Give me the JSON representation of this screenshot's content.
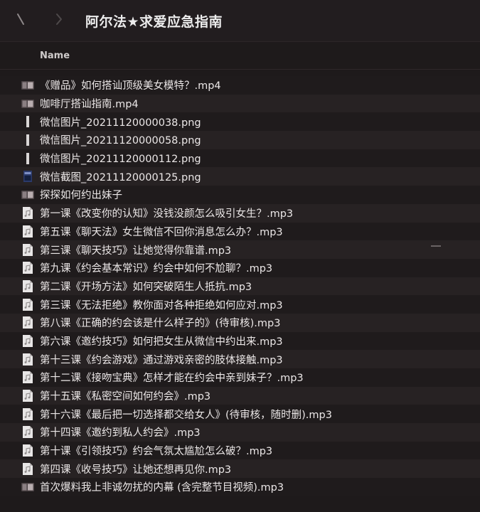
{
  "window": {
    "title": "阿尔法★求爱应急指南"
  },
  "header": {
    "name_column": "Name"
  },
  "files": [
    {
      "name": "《赠品》如何搭讪顶级美女模特？.mp4",
      "icon": "video-thumbnail-icon"
    },
    {
      "name": "咖啡厅搭讪指南.mp4",
      "icon": "video-thumbnail-icon"
    },
    {
      "name": "微信图片_20211120000038.png",
      "icon": "image-thumbnail-icon"
    },
    {
      "name": "微信图片_20211120000058.png",
      "icon": "image-thumbnail-icon"
    },
    {
      "name": "微信图片_20211120000112.png",
      "icon": "image-thumbnail-icon"
    },
    {
      "name": "微信截图_20211120000125.png",
      "icon": "screenshot-thumbnail-icon"
    },
    {
      "name": "探探如何约出妹子",
      "icon": "video-thumbnail-icon"
    },
    {
      "name": "第一课《改变你的认知》没钱没颜怎么吸引女生？.mp3",
      "icon": "audio-file-icon"
    },
    {
      "name": "第五课《聊天法》女生微信不回你消息怎么办？.mp3",
      "icon": "audio-file-icon"
    },
    {
      "name": "第三课《聊天技巧》让她觉得你靠谱.mp3",
      "icon": "audio-file-icon"
    },
    {
      "name": "第九课《约会基本常识》约会中如何不尬聊？.mp3",
      "icon": "audio-file-icon"
    },
    {
      "name": "第二课《开场方法》如何突破陌生人抵抗.mp3",
      "icon": "audio-file-icon"
    },
    {
      "name": "第三课《无法拒绝》教你面对各种拒绝如何应对.mp3",
      "icon": "audio-file-icon"
    },
    {
      "name": "第八课《正确的约会该是什么样子的》(待审核).mp3",
      "icon": "audio-file-icon"
    },
    {
      "name": "第六课《邀约技巧》如何把女生从微信中约出来.mp3",
      "icon": "audio-file-icon"
    },
    {
      "name": "第十三课《约会游戏》通过游戏亲密的肢体接触.mp3",
      "icon": "audio-file-icon"
    },
    {
      "name": "第十二课《接吻宝典》怎样才能在约会中亲到妹子？.mp3",
      "icon": "audio-file-icon"
    },
    {
      "name": "第十五课《私密空间如何约会》.mp3",
      "icon": "audio-file-icon"
    },
    {
      "name": "第十六课《最后把一切选择都交给女人》(待审核，随时删).mp3",
      "icon": "audio-file-icon"
    },
    {
      "name": "第十四课《邀约到私人约会》.mp3",
      "icon": "audio-file-icon"
    },
    {
      "name": "第十课《引领技巧》约会气氛太尴尬怎么破？.mp3",
      "icon": "audio-file-icon"
    },
    {
      "name": "第四课《收号技巧》让她还想再见你.mp3",
      "icon": "audio-file-icon"
    },
    {
      "name": "首次爆料我上非诚勿扰的内幕 (含完整节目视频).mp3",
      "icon": "video-thumbnail-icon"
    }
  ],
  "colors": {
    "background": "#1e1a1b",
    "row_alt": "#272223",
    "text": "#ebe7e7"
  }
}
